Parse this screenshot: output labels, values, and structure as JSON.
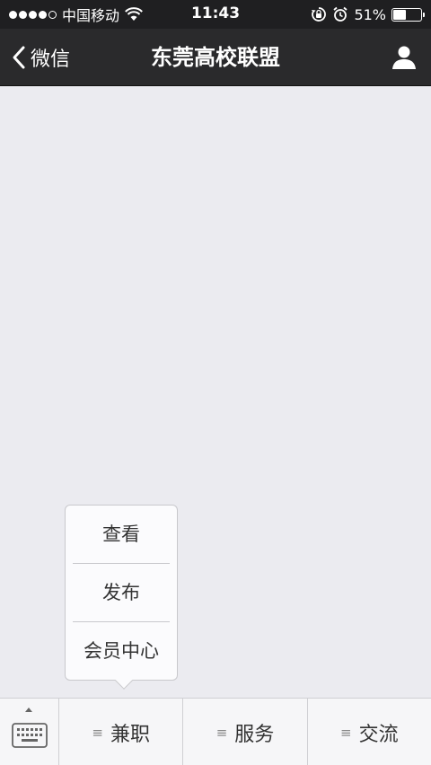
{
  "status_bar": {
    "signal_dots_filled": 4,
    "signal_dots_total": 5,
    "carrier": "中国移动",
    "time": "11:43",
    "battery_percent": "51%",
    "battery_level": 0.51
  },
  "nav": {
    "back_label": "微信",
    "title": "东莞高校联盟",
    "right_icon": "person-icon"
  },
  "popup_menu": {
    "items": [
      "查看",
      "发布",
      "会员中心"
    ]
  },
  "tabbar": {
    "keyboard_icon": "keyboard-icon",
    "menus": [
      {
        "label": "兼职",
        "icon": "menu-lines-icon"
      },
      {
        "label": "服务",
        "icon": "menu-lines-icon"
      },
      {
        "label": "交流",
        "icon": "menu-lines-icon"
      }
    ]
  },
  "colors": {
    "status_bg": "#1f1f21",
    "nav_bg": "#2a2a2c",
    "content_bg": "#ebebf0",
    "tabbar_bg": "#f6f6f8"
  }
}
